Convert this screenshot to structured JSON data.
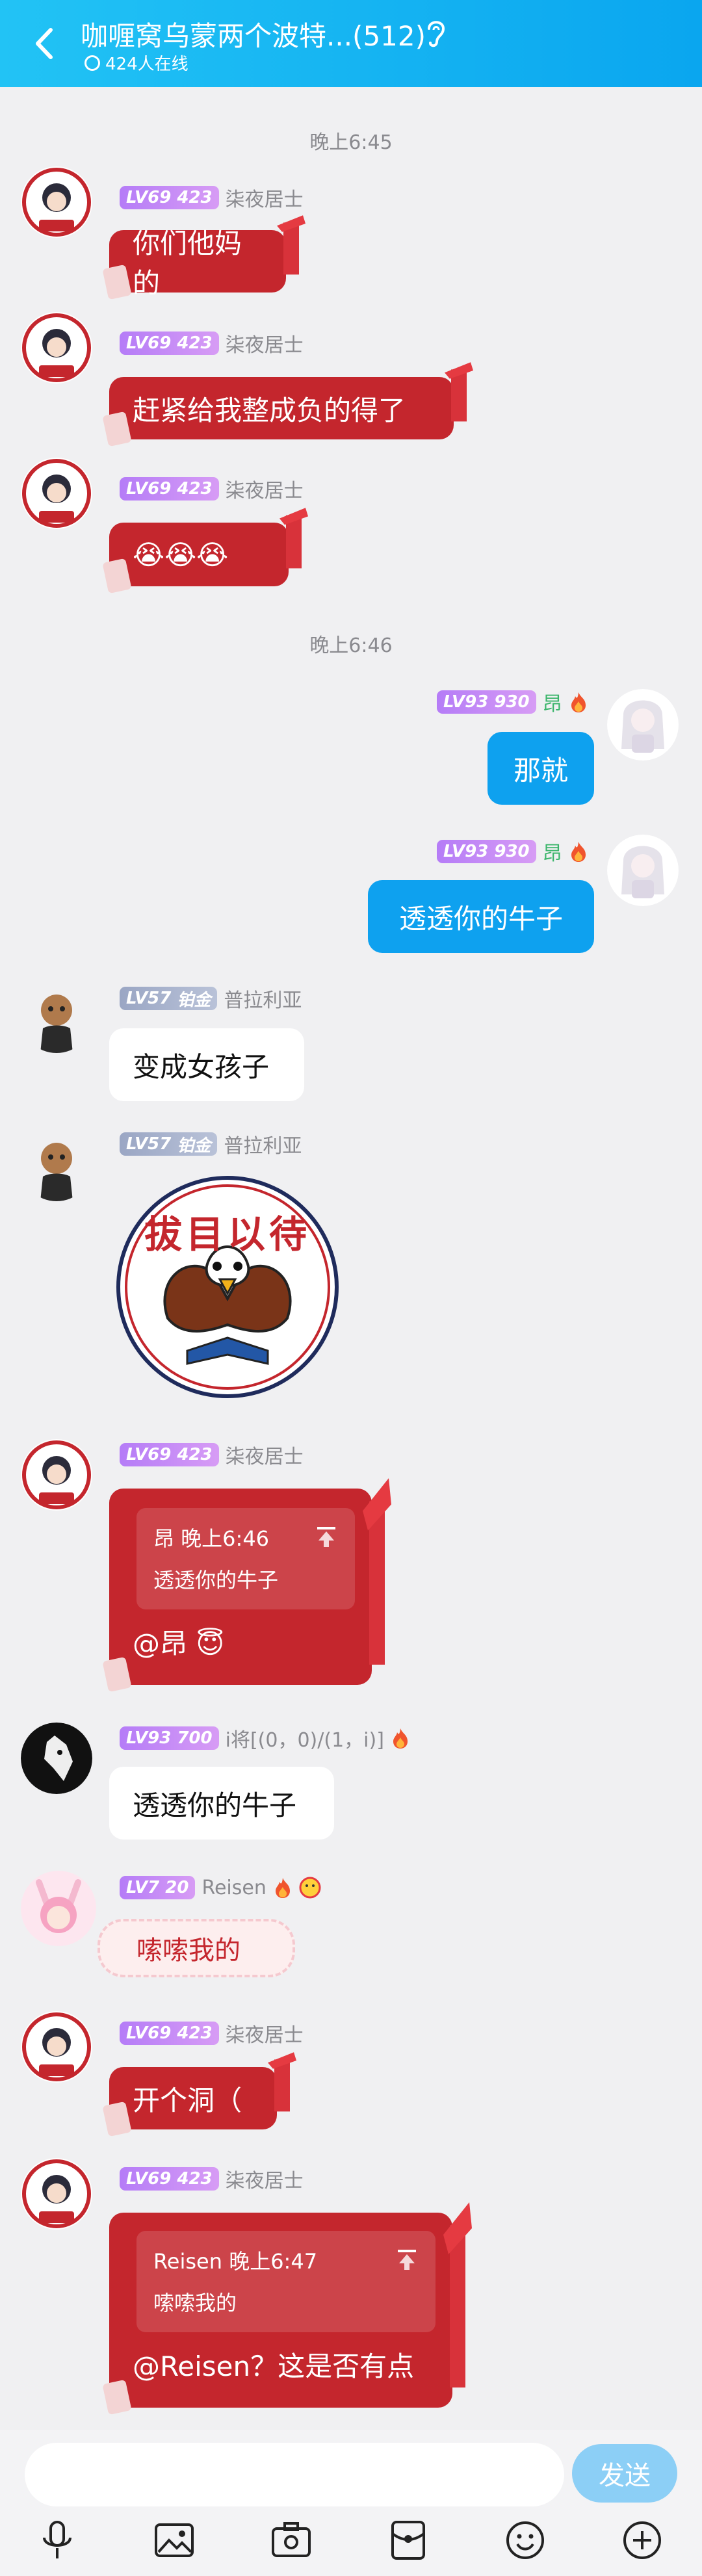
{
  "header": {
    "title": "咖喱窝乌蒙两个波特...(512)",
    "online": "424人在线"
  },
  "times": [
    "晚上6:45",
    "晚上6:46"
  ],
  "users": {
    "qiye": {
      "level": "LV69",
      "num": "423",
      "name": "柒夜居士"
    },
    "ang": {
      "level": "LV93",
      "num": "930",
      "name": "昂"
    },
    "pula": {
      "level": "LV57",
      "num": "铂金",
      "name": "普拉利亚"
    },
    "ijiang": {
      "level": "LV93",
      "num": "700",
      "name": "i将[(0，0)/(1，i)]"
    },
    "reisen": {
      "level": "LV7",
      "num": "20",
      "name": "Reisen"
    }
  },
  "messages": [
    {
      "text": "你们他妈的"
    },
    {
      "text": "赶紧给我整成负的得了"
    },
    {
      "text": "😭😭😭"
    },
    {
      "text": "那就"
    },
    {
      "text": "透透你的牛子"
    },
    {
      "text": "变成女孩子"
    },
    {
      "sticker_text": "拔目以待"
    },
    {
      "quote_head": "昂 晚上6:46",
      "quote_body": "透透你的牛子",
      "text": "@昂 😇"
    },
    {
      "text": "透透你的牛子"
    },
    {
      "text": "嗦嗦我的"
    },
    {
      "text": "开个洞（"
    },
    {
      "quote_head": "Reisen 晚上6:47",
      "quote_body": "嗦嗦我的",
      "text": "@Reisen？这是否有点"
    }
  ],
  "input": {
    "send": "发送"
  },
  "toolbar": [
    "mic-icon",
    "image-icon",
    "camera-icon",
    "redpacket-icon",
    "emoji-icon",
    "plus-icon"
  ],
  "colors": {
    "header": "#0aa6ef",
    "red_bubble": "#c4262d",
    "blue_bubble": "#0ea1ef",
    "badge_purple": "#b57cf7"
  }
}
